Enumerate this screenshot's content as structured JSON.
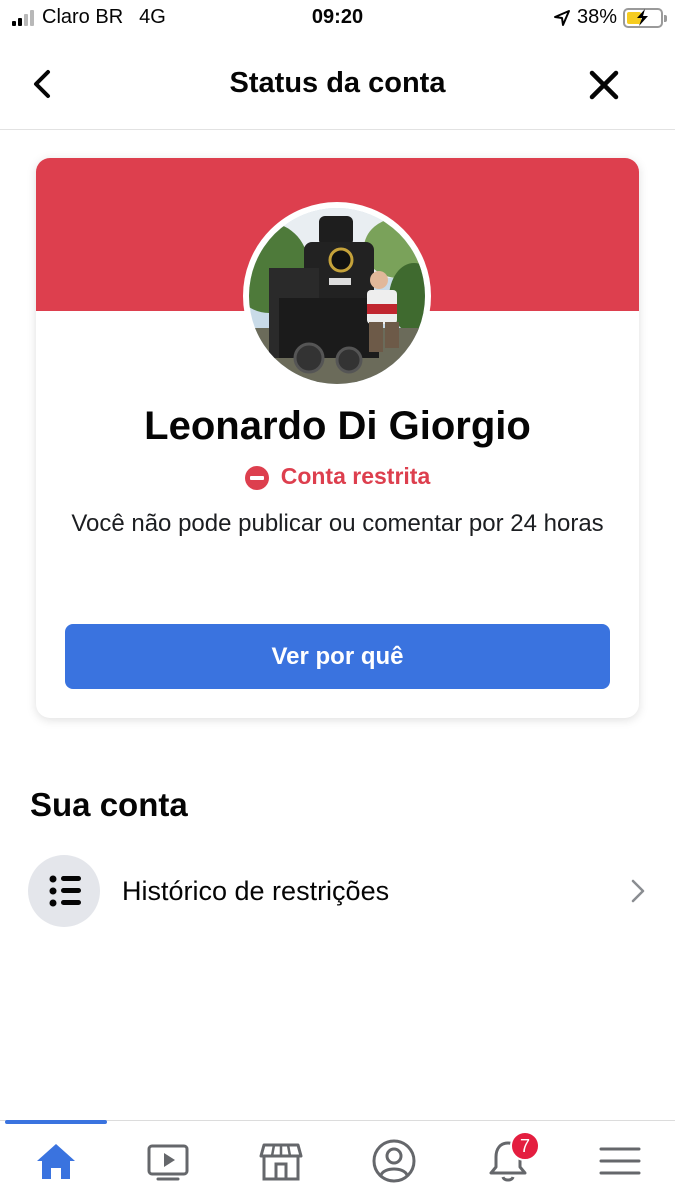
{
  "status_bar": {
    "carrier": "Claro BR",
    "network": "4G",
    "time": "09:20",
    "battery": "38%"
  },
  "header": {
    "title": "Status da conta"
  },
  "card": {
    "user_name": "Leonardo Di Giorgio",
    "status_label": "Conta restrita",
    "description": "Você não pode publicar ou comentar por 24 horas",
    "button_label": "Ver por quê"
  },
  "account": {
    "section_title": "Sua conta",
    "history_label": "Histórico de restrições"
  },
  "tabbar": {
    "notifications_badge": "7"
  },
  "colors": {
    "banner": "#dd3f4e",
    "primary_button": "#3a73df",
    "restricted_text": "#dd3f4e",
    "badge": "#e41e3f"
  },
  "icons": {
    "back": "chevron-left-icon",
    "close": "close-icon",
    "history": "list-icon",
    "home": "home-icon",
    "watch": "video-icon",
    "marketplace": "store-icon",
    "profile": "profile-icon",
    "notifications": "bell-icon",
    "menu": "menu-icon"
  }
}
